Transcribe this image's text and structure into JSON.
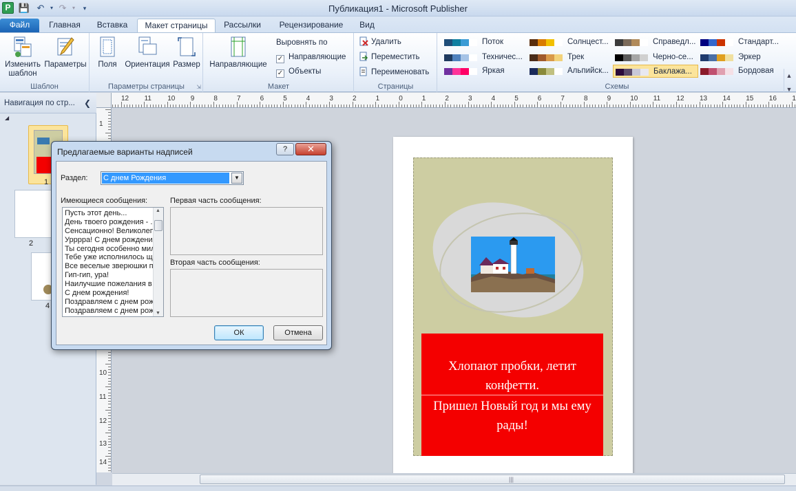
{
  "window": {
    "title": "Публикация1 - Microsoft Publisher"
  },
  "quick_access": {
    "app_icon": "publisher-icon",
    "save": "save-icon",
    "undo": "undo-icon",
    "redo": "redo-icon"
  },
  "tabs": [
    {
      "label": "Файл"
    },
    {
      "label": "Главная"
    },
    {
      "label": "Вставка"
    },
    {
      "label": "Макет страницы"
    },
    {
      "label": "Рассылки"
    },
    {
      "label": "Рецензирование"
    },
    {
      "label": "Вид"
    }
  ],
  "ribbon": {
    "template": {
      "label": "Шаблон",
      "change": "Изменить шаблон",
      "params": "Параметры"
    },
    "page_setup": {
      "label": "Параметры страницы",
      "margins": "Поля",
      "orientation": "Ориентация",
      "size": "Размер"
    },
    "layout": {
      "label": "Макет",
      "guides": "Направляющие",
      "align_to": "Выровнять по",
      "align_guides": "Направляющие",
      "align_objects": "Объекты"
    },
    "pages": {
      "label": "Страницы",
      "delete": "Удалить",
      "move": "Переместить",
      "rename": "Переименовать"
    },
    "schemes": {
      "label": "Схемы",
      "items": [
        {
          "name": "Поток",
          "colors": [
            "#1f4e79",
            "#0f7fa0",
            "#3a9bd5",
            "#ffffff"
          ]
        },
        {
          "name": "Солнцест...",
          "colors": [
            "#5a2d0c",
            "#d97b00",
            "#f2c000",
            "#ffffff"
          ]
        },
        {
          "name": "Справедл...",
          "colors": [
            "#3b3b3b",
            "#7a6a5a",
            "#b08a5a",
            "#ffffff"
          ]
        },
        {
          "name": "Стандарт...",
          "colors": [
            "#000080",
            "#3366cc",
            "#cc3300",
            "#ffffff"
          ]
        },
        {
          "name": "Техничес...",
          "colors": [
            "#1e3a5f",
            "#4f81bd",
            "#a6c3e6",
            "#ffffff"
          ]
        },
        {
          "name": "Трек",
          "colors": [
            "#4a2c1a",
            "#a05a2c",
            "#d99a4a",
            "#f2d27a"
          ]
        },
        {
          "name": "Черно-се...",
          "colors": [
            "#000000",
            "#5a5a5a",
            "#a5a5a5",
            "#d0d0d0"
          ]
        },
        {
          "name": "Эркер",
          "colors": [
            "#1f3a6e",
            "#4a6fa5",
            "#e0a020",
            "#f0e0a0"
          ]
        },
        {
          "name": "Яркая",
          "colors": [
            "#7030a0",
            "#ff3399",
            "#ff0066",
            "#ffffff"
          ]
        },
        {
          "name": "Альпийск...",
          "colors": [
            "#1a2a5a",
            "#8a8a3a",
            "#c0c080",
            "#ffffff"
          ]
        },
        {
          "name": "Баклажа...",
          "colors": [
            "#2a0a3a",
            "#5a4a6a",
            "#c8c8d8",
            "#e8e8f0"
          ]
        },
        {
          "name": "Бордовая",
          "colors": [
            "#8a1a2a",
            "#c05070",
            "#e0a0b0",
            "#f5e0e6"
          ]
        }
      ],
      "selected": "Баклажа..."
    }
  },
  "nav": {
    "header": "Навигация по стр...",
    "pages": [
      "1",
      "2",
      "4"
    ]
  },
  "ruler": {
    "top": [
      "12",
      "11",
      "10",
      "9",
      "8",
      "7",
      "6",
      "5",
      "4",
      "3",
      "2",
      "1",
      "0",
      "1",
      "2",
      "3",
      "4",
      "5",
      "6",
      "7",
      "8",
      "9",
      "10",
      "11",
      "12",
      "13",
      "14",
      "15",
      "16",
      "17"
    ],
    "left": [
      "1",
      "2",
      "10",
      "11",
      "12",
      "13",
      "14"
    ]
  },
  "publication": {
    "line1": "Хлопают пробки, летит конфетти.",
    "line2": "Пришел Новый год и мы ему рады!",
    "image": "lighthouse-clipart"
  },
  "dialog": {
    "title": "Предлагаемые варианты надписей",
    "help": "?",
    "close": "✕",
    "section_label": "Раздел:",
    "section_value": "С днем Рождения",
    "messages_label": "Имеющиеся сообщения:",
    "messages": [
      "Пусть этот день...",
      "День твоего рождения - ...",
      "Сенсационно! Великолепно!",
      "Урррра! С днем рождения!",
      "Ты сегодня особенно мил...",
      "Тебе уже исполнилось ще...",
      "Все веселые зверюшки п...",
      "Гип-гип, ура!",
      "Наилучшие пожелания в ...",
      "С днем рождения!",
      "Поздравляем с днем рож...",
      "Поздравляем с днем рож..."
    ],
    "first_part_label": "Первая часть сообщения:",
    "second_part_label": "Вторая часть сообщения:",
    "ok": "ОК",
    "cancel": "Отмена"
  }
}
